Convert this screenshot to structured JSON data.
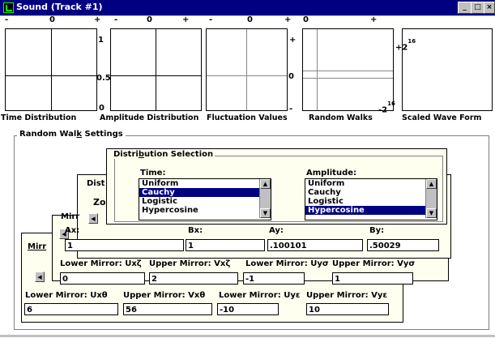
{
  "window": {
    "title": "Sound (Track #1)",
    "controls": [
      "_",
      "□",
      "×"
    ]
  },
  "graphs": {
    "scale_top": [
      {
        "left": "-",
        "mid": "0",
        "right": "+"
      },
      {
        "left": "-",
        "mid": "0",
        "right": "+"
      },
      {
        "left": "-",
        "mid": "0",
        "right": "+"
      },
      {
        "left": "0",
        "right": "+"
      }
    ],
    "amp_scale": {
      "top": "1",
      "mid": "0.5",
      "bottom": "0"
    },
    "fluct_scale": {
      "top": "+",
      "mid": "0",
      "bottom": "-"
    },
    "walk_scale": {
      "top": "+2",
      "top_exp": "16",
      "bottom": "-2",
      "bottom_exp": "16"
    },
    "captions": [
      "Time Distribution",
      "Amplitude Distribution",
      "Fluctuation Values",
      "Random Walks",
      "Scaled Wave Form"
    ]
  },
  "random_walk": {
    "title_pre": "Random Wal",
    "title_u": "k",
    "title_post": " Settings"
  },
  "dist_selection": {
    "title_pre": "Distri",
    "title_u": "b",
    "title_post": "ution  Selection",
    "time_label": "Time:",
    "amp_label": "Amplitude:",
    "time_items": [
      "Uniform",
      "Cauchy",
      "Logistic",
      "Hypercosine"
    ],
    "time_selected": 1,
    "amp_items": [
      "Uniform",
      "Cauchy",
      "Logistic",
      "Hypercosine"
    ],
    "amp_selected": 3
  },
  "behind": {
    "dist": "Dist",
    "zo": "Zo",
    "mirr1": "Mirr",
    "mirr2": "Mirr"
  },
  "coeffs": {
    "ax_label": "Ax:",
    "ax_value": "1",
    "bx_label": "Bx:",
    "bx_value": "1",
    "ay_label": "Ay:",
    "ay_value": ".100101",
    "by_label": "By:",
    "by_value": ".50029"
  },
  "mirrors1": {
    "l1": "Lower Mirror: Uxζ",
    "v1": "0",
    "l2": "Upper Mirror: Vxζ",
    "v2": "2",
    "l3": "Lower Mirror: Uyσ",
    "v3": "-1",
    "l4": "Upper Mirror: Vyσ",
    "v4": "1"
  },
  "mirrors2": {
    "l1": "Lower Mirror: Uxθ",
    "v1": "6",
    "l2": "Upper Mirror: Vxθ",
    "v2": "56",
    "l3": "Lower Mirror: Uyε",
    "v3": "-10",
    "l4": "Upper Mirror: Vyε",
    "v4": "10"
  }
}
